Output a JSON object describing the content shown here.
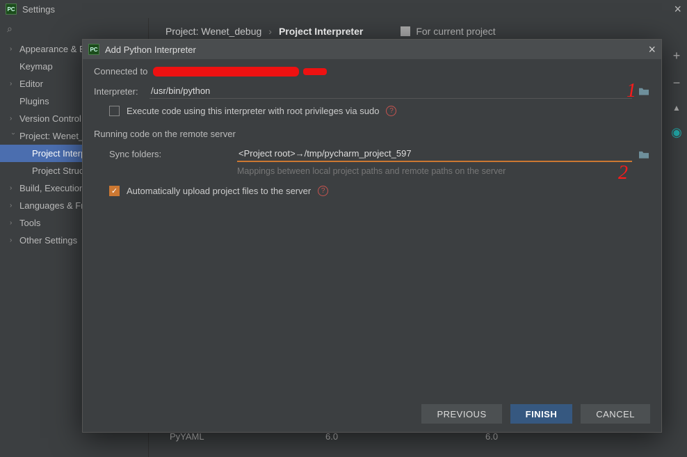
{
  "window": {
    "title": "Settings",
    "close_glyph": "×"
  },
  "breadcrumb": {
    "project": "Project: Wenet_debug",
    "sep": "›",
    "page": "Project Interpreter",
    "for_project": "For current project"
  },
  "sidebar": {
    "search_glyph": "⌕",
    "items": [
      {
        "label": "Appearance & Behavior",
        "expandable": true,
        "open": false
      },
      {
        "label": "Keymap",
        "expandable": false
      },
      {
        "label": "Editor",
        "expandable": true,
        "open": false
      },
      {
        "label": "Plugins",
        "expandable": false
      },
      {
        "label": "Version Control",
        "expandable": true,
        "open": false
      },
      {
        "label": "Project: Wenet_debug",
        "expandable": true,
        "open": true
      },
      {
        "label": "Project Interpreter",
        "child": true,
        "selected": true
      },
      {
        "label": "Project Structure",
        "child": true
      },
      {
        "label": "Build, Execution, Deployment",
        "expandable": true,
        "open": false
      },
      {
        "label": "Languages & Frameworks",
        "expandable": true,
        "open": false
      },
      {
        "label": "Tools",
        "expandable": true,
        "open": false
      },
      {
        "label": "Other Settings",
        "expandable": true,
        "open": false
      }
    ]
  },
  "gutter": {
    "plus": "+",
    "minus": "−",
    "up": "▲",
    "eye": "◉"
  },
  "pkg_row": {
    "name": "PyYAML",
    "ver": "6.0",
    "latest": "6.0"
  },
  "dialog": {
    "title": "Add Python Interpreter",
    "close_glyph": "×",
    "connected_label": "Connected to",
    "interpreter_label": "Interpreter:",
    "interpreter_value": "/usr/bin/python",
    "exec_root_label": "Execute code using this interpreter with root privileges via sudo",
    "remote_header": "Running code on the remote server",
    "sync_label": "Sync folders:",
    "sync_value": "<Project root>→/tmp/pycharm_project_597",
    "sync_hint": "Mappings between local project paths and remote paths on the server",
    "auto_upload_label": "Automatically upload project files to the server",
    "annot1": "1",
    "annot2": "2",
    "buttons": {
      "previous": "PREVIOUS",
      "finish": "FINISH",
      "cancel": "CANCEL"
    }
  }
}
